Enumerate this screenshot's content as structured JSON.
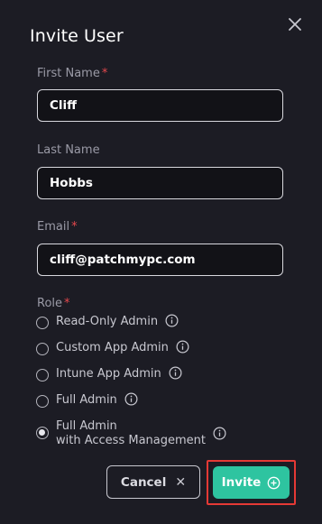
{
  "dialog": {
    "title": "Invite User",
    "close_icon": "close-icon"
  },
  "form": {
    "first_name": {
      "label": "First Name",
      "required_mark": "*",
      "value": "Cliff"
    },
    "last_name": {
      "label": "Last Name",
      "value": "Hobbs"
    },
    "email": {
      "label": "Email",
      "required_mark": "*",
      "value": "cliff@patchmypc.com"
    },
    "role": {
      "label": "Role",
      "required_mark": "*",
      "options": [
        {
          "label": "Read-Only Admin",
          "checked": false,
          "icon": "info-icon"
        },
        {
          "label": "Custom App Admin",
          "checked": false,
          "icon": "info-icon"
        },
        {
          "label": "Intune App Admin",
          "checked": false,
          "icon": "info-icon"
        },
        {
          "label": "Full Admin",
          "checked": false,
          "icon": "info-icon"
        },
        {
          "label_line1": "Full Admin",
          "label_line2": "with Access Management",
          "checked": true,
          "icon": "info-icon"
        }
      ]
    }
  },
  "actions": {
    "cancel_label": "Cancel",
    "cancel_icon": "close-icon",
    "invite_label": "Invite",
    "invite_icon": "plus-circle-icon",
    "highlight_color": "#e53935"
  },
  "colors": {
    "background": "#1c1c24",
    "accent": "#2ec4a0",
    "required": "#e5484d"
  }
}
